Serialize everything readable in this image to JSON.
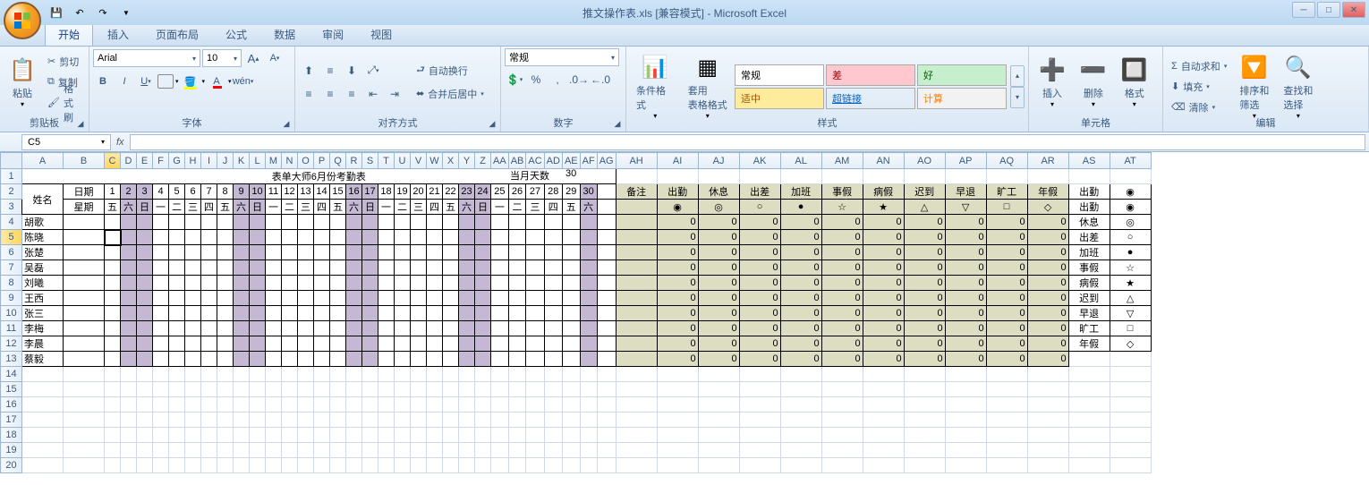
{
  "title": "推文操作表.xls  [兼容模式] - Microsoft Excel",
  "tabs": [
    "开始",
    "插入",
    "页面布局",
    "公式",
    "数据",
    "审阅",
    "视图"
  ],
  "activeTab": 0,
  "clipboard": {
    "paste": "粘贴",
    "cut": "剪切",
    "copy": "复制",
    "painter": "格式刷",
    "label": "剪贴板"
  },
  "font": {
    "name": "Arial",
    "size": "10",
    "label": "字体"
  },
  "align": {
    "wrap": "自动换行",
    "merge": "合并后居中",
    "label": "对齐方式"
  },
  "number": {
    "format": "常规",
    "label": "数字"
  },
  "styles": {
    "cond": "条件格式",
    "table": "套用\n表格格式",
    "normal": "常规",
    "bad": "差",
    "good": "好",
    "neutral": "适中",
    "link": "超链接",
    "calc": "计算",
    "label": "样式"
  },
  "cells": {
    "insert": "插入",
    "delete": "删除",
    "format": "格式",
    "label": "单元格"
  },
  "editing": {
    "sum": "自动求和",
    "fill": "填充",
    "clear": "清除",
    "sort": "排序和\n筛选",
    "find": "查找和\n选择",
    "label": "编辑"
  },
  "namebox": "C5",
  "sheet": {
    "title": "表单大师6月份考勤表",
    "monthDaysLabel": "当月天数",
    "monthDays": "30",
    "nameHeader": "姓名",
    "dateHeader": "日期",
    "weekHeader": "星期",
    "days": [
      "1",
      "2",
      "3",
      "4",
      "5",
      "6",
      "7",
      "8",
      "9",
      "10",
      "11",
      "12",
      "13",
      "14",
      "15",
      "16",
      "17",
      "18",
      "19",
      "20",
      "21",
      "22",
      "23",
      "24",
      "25",
      "26",
      "27",
      "28",
      "29",
      "30"
    ],
    "weekdays": [
      "五",
      "六",
      "日",
      "一",
      "二",
      "三",
      "四",
      "五",
      "六",
      "日",
      "一",
      "二",
      "三",
      "四",
      "五",
      "六",
      "日",
      "一",
      "二",
      "三",
      "四",
      "五",
      "六",
      "日",
      "一",
      "二",
      "三",
      "四",
      "五",
      "六"
    ],
    "weekendCols": [
      1,
      2,
      8,
      9,
      15,
      16,
      22,
      23,
      29
    ],
    "names": [
      "胡歌",
      "陈晓",
      "张楚",
      "吴磊",
      "刘曦",
      "王西",
      "张三",
      "李梅",
      "李晨",
      "蔡毅"
    ],
    "statHeaders": [
      "备注",
      "出勤",
      "休息",
      "出差",
      "加班",
      "事假",
      "病假",
      "迟到",
      "早退",
      "旷工",
      "年假"
    ],
    "statSymbols": [
      "",
      "◉",
      "◎",
      "○",
      "●",
      "☆",
      "★",
      "△",
      "▽",
      "□",
      "◇"
    ],
    "legendHeader": "出勤",
    "legend": [
      [
        "出勤",
        "◉"
      ],
      [
        "休息",
        "◎"
      ],
      [
        "出差",
        "○"
      ],
      [
        "加班",
        "●"
      ],
      [
        "事假",
        "☆"
      ],
      [
        "病假",
        "★"
      ],
      [
        "迟到",
        "△"
      ],
      [
        "早退",
        "▽"
      ],
      [
        "旷工",
        "□"
      ],
      [
        "年假",
        "◇"
      ]
    ]
  }
}
